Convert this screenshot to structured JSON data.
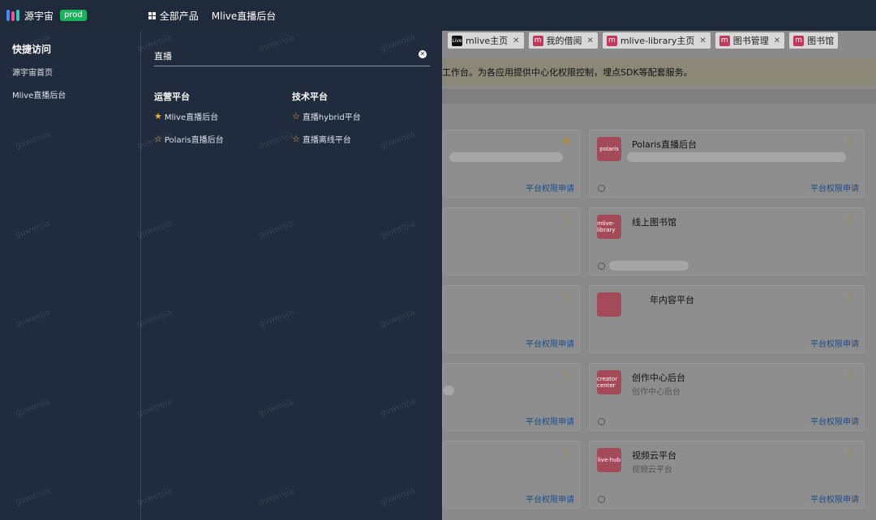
{
  "header": {
    "app_name": "源宇宙",
    "env_badge": "prod",
    "all_products": "全部产品",
    "current_product": "Mlive直播后台"
  },
  "quick_access": {
    "title": "快捷访问",
    "items": [
      "源宇宙首页",
      "Mlive直播后台"
    ]
  },
  "search": {
    "query": "直播",
    "groups": [
      {
        "title": "运营平台",
        "results": [
          {
            "label": "Mlive直播后台",
            "starred": true
          },
          {
            "label": "Polaris直播后台",
            "starred": false
          }
        ]
      },
      {
        "title": "技术平台",
        "results": [
          {
            "label": "直播hybrid平台",
            "starred": false
          },
          {
            "label": "直播离线平台",
            "starred": false
          }
        ]
      }
    ]
  },
  "tabs": [
    {
      "icon": "Live",
      "label": "mlive主页"
    },
    {
      "icon": "m",
      "label": "我的借阅"
    },
    {
      "icon": "m",
      "label": "mlive-library主页"
    },
    {
      "icon": "m",
      "label": "图书管理"
    },
    {
      "icon": "m",
      "label": "图书馆"
    }
  ],
  "notice": "工作台。为各应用提供中心化权限控制，埋点SDK等配套服务。",
  "cards": {
    "apply_label": "平台权限申请",
    "items": [
      {
        "icon_text": "polaris",
        "title": "Polaris直播后台",
        "subtitle": ""
      },
      {
        "icon_text": "mlive-library",
        "title": "线上图书馆",
        "subtitle": ""
      },
      {
        "icon_text": "",
        "title": "年内容平台",
        "subtitle": ""
      },
      {
        "icon_text": "creator center",
        "title": "创作中心后台",
        "subtitle": "创作中心后台"
      },
      {
        "icon_text": "live-hub",
        "title": "视频云平台",
        "subtitle": "视频云平台"
      }
    ]
  },
  "watermark": "guwenjia",
  "colors": {
    "header_bg": "#1f2a3b",
    "panel_bg": "#202b3d",
    "badge_green": "#19b45a",
    "star_gold": "#e7b43a",
    "link_blue": "#1d6fcf"
  }
}
